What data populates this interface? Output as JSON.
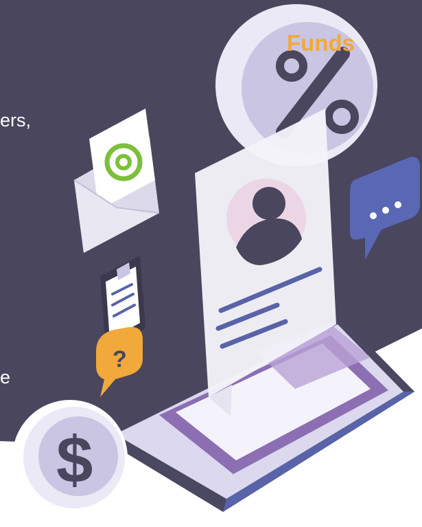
{
  "text": {
    "heading_fragment": "Funds",
    "line_fragment_1": "ers,",
    "line_fragment_2": "e"
  },
  "colors": {
    "panel": "#49465d",
    "accent_orange": "#f0a93a",
    "lavender": "#c9c5e3",
    "purple": "#8c6fb3",
    "blue_lines": "#5863a8",
    "green_at": "#7cbf3a",
    "speech_bubble": "#5a67b5"
  },
  "icons": [
    "percent-icon",
    "email-icon",
    "at-icon",
    "clipboard-icon",
    "question-icon",
    "dollar-icon",
    "chat-bubble-icon",
    "user-avatar-icon",
    "tablet-icon",
    "profile-card-icon"
  ]
}
